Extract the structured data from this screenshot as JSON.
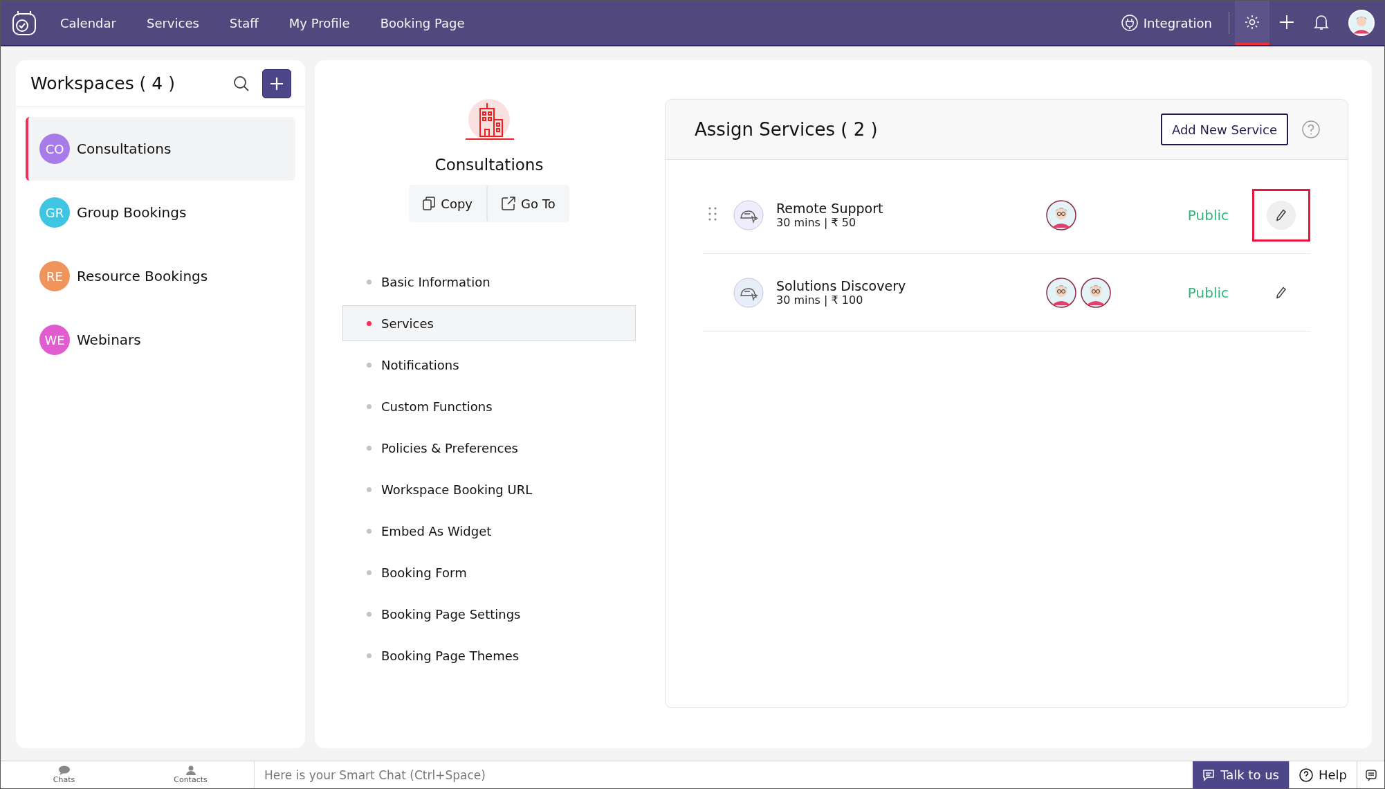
{
  "topbar": {
    "nav": [
      {
        "label": "Calendar",
        "selected": false
      },
      {
        "label": "Services",
        "selected": false
      },
      {
        "label": "Staff",
        "selected": false
      },
      {
        "label": "My Profile",
        "selected": false
      },
      {
        "label": "Booking Page",
        "selected": false
      }
    ],
    "integration": "Integration",
    "tools": [
      {
        "kind": "settings",
        "selected": true
      },
      {
        "kind": "add",
        "selected": false
      },
      {
        "kind": "bell",
        "selected": false
      }
    ]
  },
  "sidebar": {
    "title": "Workspaces ( 4 )",
    "items": [
      {
        "initials": "CO",
        "label": "Consultations",
        "color": "#a77be8",
        "selected": true
      },
      {
        "initials": "GR",
        "label": "Group Bookings",
        "color": "#3fc4e2",
        "selected": false
      },
      {
        "initials": "RE",
        "label": "Resource Bookings",
        "color": "#f0945e",
        "selected": false
      },
      {
        "initials": "WE",
        "label": "Webinars",
        "color": "#e05ccf",
        "selected": false
      }
    ]
  },
  "workspace": {
    "name": "Consultations",
    "actions": [
      {
        "kind": "copy",
        "label": "Copy"
      },
      {
        "kind": "goto",
        "label": "Go To"
      }
    ],
    "menu": [
      {
        "label": "Basic Information",
        "selected": false
      },
      {
        "label": "Services",
        "selected": true
      },
      {
        "label": "Notifications",
        "selected": false
      },
      {
        "label": "Custom Functions",
        "selected": false
      },
      {
        "label": "Policies & Preferences",
        "selected": false
      },
      {
        "label": "Workspace Booking URL",
        "selected": false
      },
      {
        "label": "Embed As Widget",
        "selected": false
      },
      {
        "label": "Booking Form",
        "selected": false
      },
      {
        "label": "Booking Page Settings",
        "selected": false
      },
      {
        "label": "Booking Page Themes",
        "selected": false
      }
    ]
  },
  "services": {
    "title": "Assign Services ( 2 )",
    "add_button": "Add New Service",
    "rows": [
      {
        "name": "Remote Support",
        "meta": "30 mins | ₹ 50",
        "staff": [
          {
            "kind": "avatar"
          }
        ],
        "visibility": "Public",
        "highlighted": true,
        "draggable": true,
        "color": "#f1ecfb"
      },
      {
        "name": "Solutions Discovery",
        "meta": "30 mins | ₹ 100",
        "staff": [
          {
            "kind": "avatar"
          },
          {
            "kind": "avatar"
          }
        ],
        "visibility": "Public",
        "highlighted": false,
        "draggable": false,
        "color": "#e8eef8"
      }
    ]
  },
  "footer": {
    "tabs": [
      {
        "label": "Chats",
        "kind": "chat"
      },
      {
        "label": "Contacts",
        "kind": "contact"
      }
    ],
    "chat_placeholder": "Here is your Smart Chat (Ctrl+Space)",
    "talk": "Talk to us",
    "help": "Help"
  }
}
